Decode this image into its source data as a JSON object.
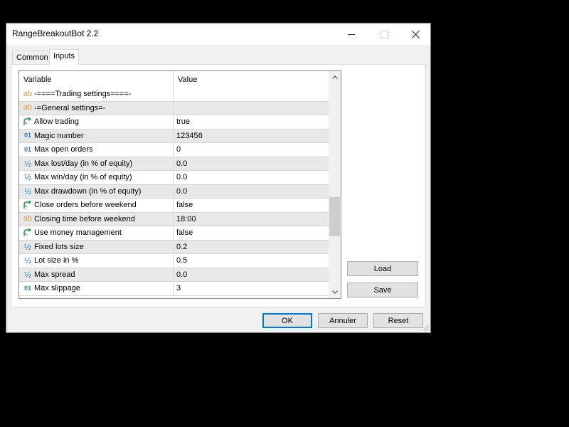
{
  "window": {
    "title": "RangeBreakoutBot 2.2",
    "controls": {
      "minimize": "minimize",
      "maximize": "maximize",
      "close": "close"
    }
  },
  "tabs": [
    {
      "label": "Common",
      "active": false
    },
    {
      "label": "Inputs",
      "active": true
    }
  ],
  "grid": {
    "columns": {
      "variable": "Variable",
      "value": "Value"
    },
    "rows": [
      {
        "icon": "ab",
        "type": "string",
        "variable": "-====Trading settings====-",
        "value": ""
      },
      {
        "icon": "ab",
        "type": "string",
        "variable": "-=General settings=-",
        "value": ""
      },
      {
        "icon": "bool",
        "type": "bool",
        "variable": "Allow trading",
        "value": "true"
      },
      {
        "icon": "01",
        "type": "int",
        "variable": "Magic number",
        "value": "123456"
      },
      {
        "icon": "01",
        "type": "int",
        "variable": "Max open orders",
        "value": "0"
      },
      {
        "icon": "½",
        "type": "double",
        "variable": "Max lost/day (in % of equity)",
        "value": "0.0"
      },
      {
        "icon": "½",
        "type": "double",
        "variable": "Max win/day (in % of equity)",
        "value": "0.0"
      },
      {
        "icon": "½",
        "type": "double",
        "variable": "Max drawdown (in % of equity)",
        "value": "0.0"
      },
      {
        "icon": "bool",
        "type": "bool",
        "variable": "Close orders before weekend",
        "value": "false"
      },
      {
        "icon": "ab",
        "type": "string",
        "variable": "Closing time before weekend",
        "value": "18:00"
      },
      {
        "icon": "bool",
        "type": "bool",
        "variable": "Use money management",
        "value": "false"
      },
      {
        "icon": "½",
        "type": "double",
        "variable": "Fixed lots size",
        "value": "0.2"
      },
      {
        "icon": "½",
        "type": "double",
        "variable": "Lot size in %",
        "value": "0.5"
      },
      {
        "icon": "½",
        "type": "double",
        "variable": "Max spread",
        "value": "0.0"
      },
      {
        "icon": "01",
        "type": "int",
        "variable": "Max slippage",
        "value": "3"
      }
    ],
    "scroll_position_fraction": 0.55
  },
  "buttons": {
    "load": "Load",
    "save": "Save",
    "ok": "OK",
    "cancel": "Annuler",
    "reset": "Reset"
  },
  "colors": {
    "string_icon": "#d8a040",
    "number_icon": "#3a7fc0",
    "bool_icon": "#2e9e4a",
    "default_button_border": "#0078d7"
  }
}
